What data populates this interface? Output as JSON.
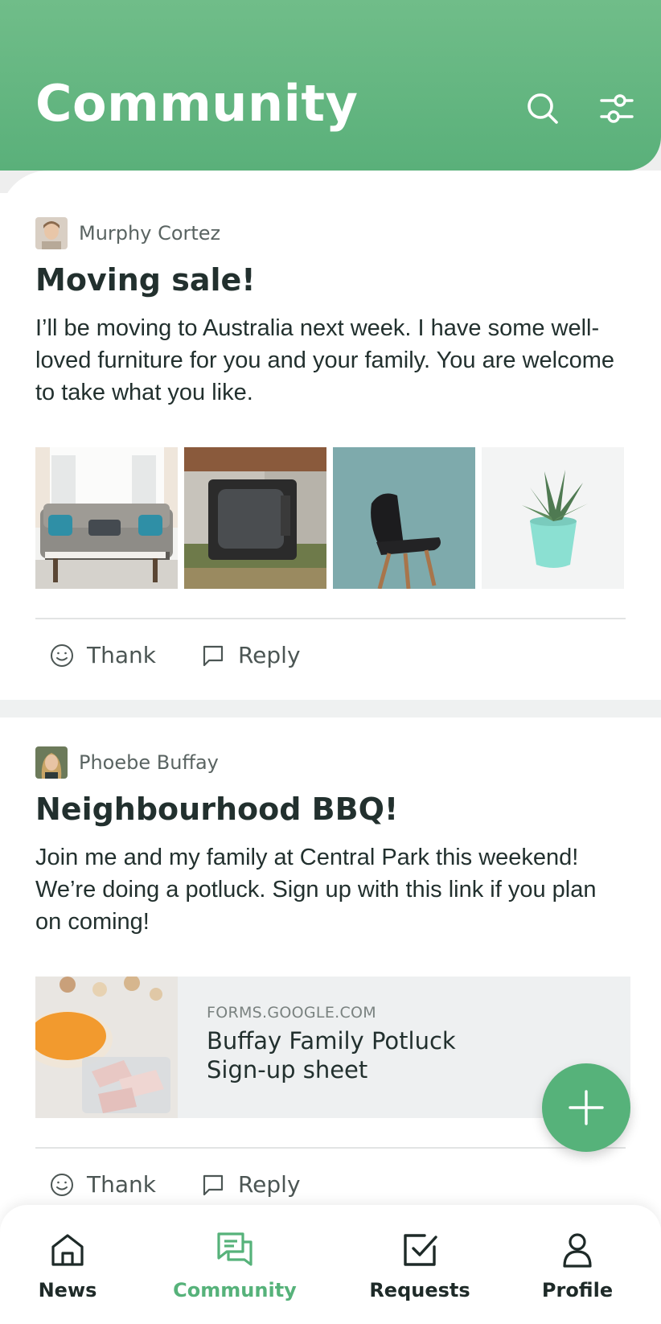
{
  "header": {
    "title": "Community",
    "actions": [
      {
        "icon": "search-icon"
      },
      {
        "icon": "filter-icon"
      }
    ]
  },
  "posts": [
    {
      "author": "Murphy Cortez",
      "title": "Moving sale!",
      "body": "I’ll be moving to Australia next week. I have some well-loved furniture for you and your family. You are welcome to take what you like.",
      "photos": [
        "sofa",
        "old tv",
        "black chair",
        "potted plant"
      ],
      "actions": {
        "thank": "Thank",
        "reply": "Reply"
      }
    },
    {
      "author": "Phoebe Buffay",
      "title": "Neighbourhood BBQ!",
      "body": "Join me and my family at Central Park this weekend! We’re doing a potluck. Sign up with this link if you plan on coming!",
      "link": {
        "domain": "FORMS.GOOGLE.COM",
        "title": "Buffay Family Potluck Sign-up sheet"
      },
      "actions": {
        "thank": "Thank",
        "reply": "Reply"
      }
    }
  ],
  "fab": {
    "icon": "plus-icon"
  },
  "nav": {
    "items": [
      {
        "label": "News",
        "icon": "home-icon",
        "active": false
      },
      {
        "label": "Community",
        "icon": "chat-icon",
        "active": true
      },
      {
        "label": "Requests",
        "icon": "checkbox-icon",
        "active": false
      },
      {
        "label": "Profile",
        "icon": "person-icon",
        "active": false
      }
    ]
  },
  "colors": {
    "brand_green": "#5ab07a",
    "text_dark": "#22302e",
    "text_muted": "#5a6462"
  }
}
